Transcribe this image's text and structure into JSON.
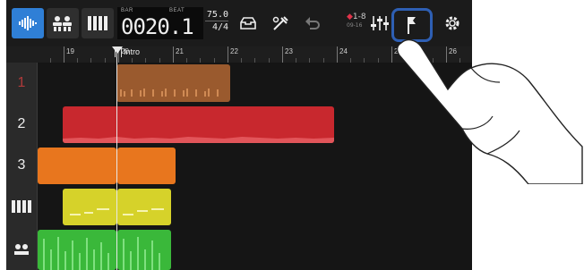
{
  "toolbar": {
    "counter_bar_label": "BAR",
    "counter_beat_label": "BEAT",
    "counter_value": "0020.1",
    "tempo": "75.0",
    "time_signature": "4/4",
    "track_range": "1-8",
    "track_range_sub": "09-16",
    "icons": [
      "track-view-icon",
      "mixer-icon",
      "keyboard-icon",
      "tray-icon",
      "tools-icon",
      "undo-icon",
      "faders-icon",
      "marker-icon",
      "settings-gear-icon"
    ]
  },
  "ruler": {
    "bars": [
      "19",
      "20",
      "21",
      "22",
      "23",
      "24",
      "25",
      "26"
    ],
    "marker_label": "Intro"
  },
  "tracks": [
    {
      "number": "1",
      "color": "#9a5a2e"
    },
    {
      "number": "2",
      "color": "#c8282e"
    },
    {
      "number": "3",
      "color": "#e8761e"
    },
    {
      "icon": "piano-icon",
      "color": "#d6d22a"
    },
    {
      "icon": "drums-icon",
      "color": "#3ab83a"
    }
  ],
  "colors": {
    "accent": "#2f7fd6",
    "highlight_outline": "#2e5fb4",
    "background": "#141414"
  }
}
